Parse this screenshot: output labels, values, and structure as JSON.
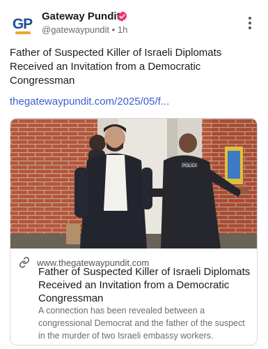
{
  "post": {
    "author_name": "Gateway Pundit",
    "avatar_text": "GP",
    "handle": "@gatewaypundit",
    "separator": "•",
    "time": "1h",
    "text": "Father of Suspected Killer of Israeli Diplomats Received an Invitation from a Democratic Congressman",
    "link_text": "thegatewaypundit.com/2025/05/f..."
  },
  "card": {
    "domain": "www.thegatewaypundit.com",
    "title": "Father of Suspected Killer of Israeli Diplomats Received an Invitation from a Democratic Congressman",
    "description": "A connection has been revealed between a congressional Democrat and the father of the suspect in the murder of two Israeli embassy workers.",
    "image_badge_text": "POLICE"
  },
  "icons": {
    "verified": "verified-badge-icon",
    "more": "more-vertical-icon",
    "link": "link-icon"
  },
  "colors": {
    "brand_blue": "#1d4f9c",
    "brand_orange": "#f0a52c",
    "verified_pink": "#e8386e",
    "link_blue": "#3a5fcd"
  }
}
